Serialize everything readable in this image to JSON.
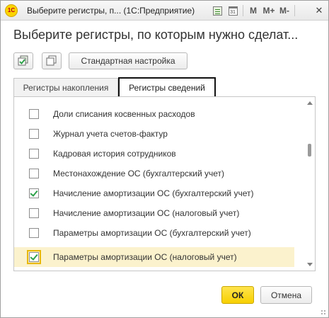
{
  "window": {
    "logo_text": "1С",
    "title": "Выберите регистры, п...  (1С:Предприятие)",
    "icons": [
      "1c-logo-icon",
      "document-icon",
      "calendar-icon",
      "memory-m-icon",
      "memory-plus-icon",
      "memory-minus-icon",
      "minimize-icon",
      "close-icon"
    ],
    "m_label": "M",
    "mplus_label": "M+",
    "mminus_label": "M-",
    "minimize_label": "–",
    "close_label": "✕"
  },
  "heading": "Выберите регистры, по которым нужно сделат...",
  "toolbar": {
    "check_all_icon": "check-all-icon",
    "uncheck_all_icon": "uncheck-all-icon",
    "standard_button": "Стандартная настройка"
  },
  "tabs": [
    {
      "label": "Регистры накопления",
      "active": false
    },
    {
      "label": "Регистры сведений",
      "active": true
    }
  ],
  "rows": [
    {
      "label": "Доли списания косвенных расходов",
      "checked": false,
      "selected": false
    },
    {
      "label": "Журнал учета счетов-фактур",
      "checked": false,
      "selected": false
    },
    {
      "label": "Кадровая история сотрудников",
      "checked": false,
      "selected": false
    },
    {
      "label": "Местонахождение ОС (бухгалтерский учет)",
      "checked": false,
      "selected": false
    },
    {
      "label": "Начисление амортизации ОС (бухгалтерский учет)",
      "checked": true,
      "selected": false
    },
    {
      "label": "Начисление амортизации ОС (налоговый учет)",
      "checked": false,
      "selected": false
    },
    {
      "label": "Параметры амортизации ОС (бухгалтерский учет)",
      "checked": false,
      "selected": false
    },
    {
      "label": "Параметры амортизации ОС (налоговый учет)",
      "checked": true,
      "selected": true
    }
  ],
  "footer": {
    "ok_label": "ОК",
    "cancel_label": "Отмена"
  },
  "colors": {
    "accent_yellow": "#f7d000",
    "selected_row": "#fbf2cd",
    "check_green": "#2ea24a"
  }
}
